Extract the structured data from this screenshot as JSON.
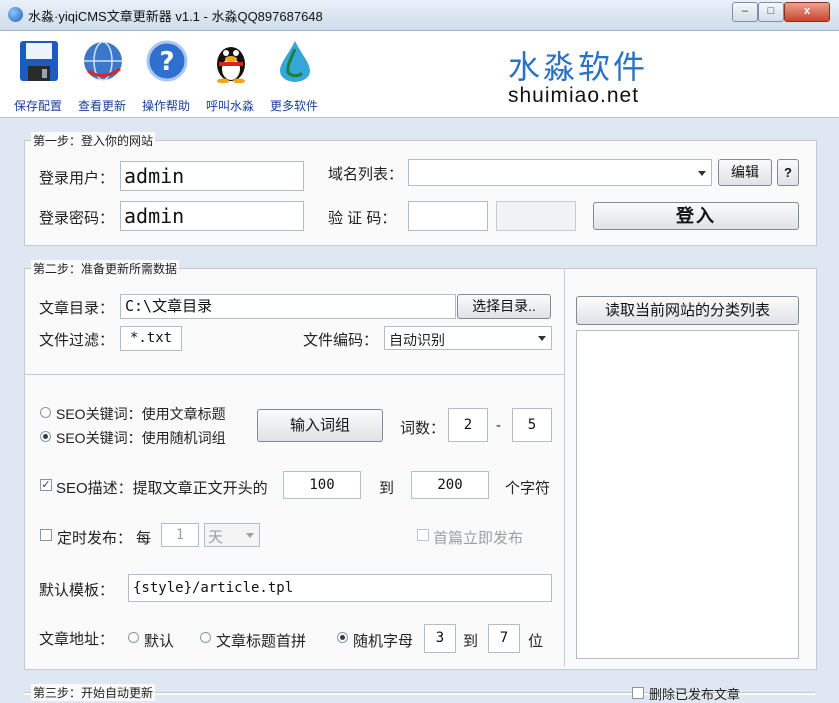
{
  "window": {
    "title": "水淼·yiqiCMS文章更新器 v1.1 - 水淼QQ897687648",
    "minimize_label": "–",
    "maximize_label": "□",
    "close_label": "x"
  },
  "toolbar": {
    "items": [
      {
        "label": "保存配置",
        "icon": "save-icon"
      },
      {
        "label": "查看更新",
        "icon": "globe-icon"
      },
      {
        "label": "操作帮助",
        "icon": "help-icon"
      },
      {
        "label": "呼叫水淼",
        "icon": "qq-penguin-icon"
      },
      {
        "label": "更多软件",
        "icon": "water-drop-icon"
      }
    ],
    "brand_cn": "水淼软件",
    "brand_en": "shuimiao.net"
  },
  "step1": {
    "legend": "第一步：登入你的网站",
    "user_label": "登录用户：",
    "user_value": "admin",
    "pass_label": "登录密码：",
    "pass_value": "admin",
    "domain_label": "域名列表：",
    "domain_value": "",
    "edit_button": "编辑",
    "help_button": "?",
    "captcha_label": "验 证 码：",
    "captcha_value": "",
    "login_button": "登入"
  },
  "step2": {
    "legend": "第二步：准备更新所需数据",
    "dir_label": "文章目录：",
    "dir_value": "C:\\文章目录",
    "choose_dir_button": "选择目录..",
    "filter_label": "文件过滤：",
    "filter_value": "*.txt",
    "encoding_label": "文件编码：",
    "encoding_value": "自动识别",
    "read_categories_button": "读取当前网站的分类列表",
    "seo_keyword_title_label": "SEO关键词：使用文章标题",
    "seo_keyword_random_label": "SEO关键词：使用随机词组",
    "input_words_button": "输入词组",
    "word_count_label": "词数：",
    "word_min": "2",
    "word_dash": "-",
    "word_max": "5",
    "seo_desc_label": "SEO描述：提取文章正文开头的",
    "desc_from": "100",
    "desc_to_label": "到",
    "desc_to": "200",
    "desc_unit_label": "个字符",
    "timed_publish_label": "定时发布：",
    "every_label": "每",
    "timed_value": "1",
    "timed_unit": "天",
    "first_publish_label": "首篇立即发布",
    "template_label": "默认模板：",
    "template_value": "{style}/article.tpl",
    "url_label": "文章地址：",
    "url_default_label": "默认",
    "url_pinyin_label": "文章标题首拼",
    "url_random_label": "随机字母",
    "url_from": "3",
    "url_to_label": "到",
    "url_to": "7",
    "url_unit_label": "位"
  },
  "step3": {
    "legend": "第三步：开始自动更新",
    "delete_published_label": "删除已发布文章"
  },
  "colors": {
    "accent_blue": "#2a72c4",
    "toolbar_label": "#1b3f9a",
    "window_bg": "#dfe8f2"
  }
}
